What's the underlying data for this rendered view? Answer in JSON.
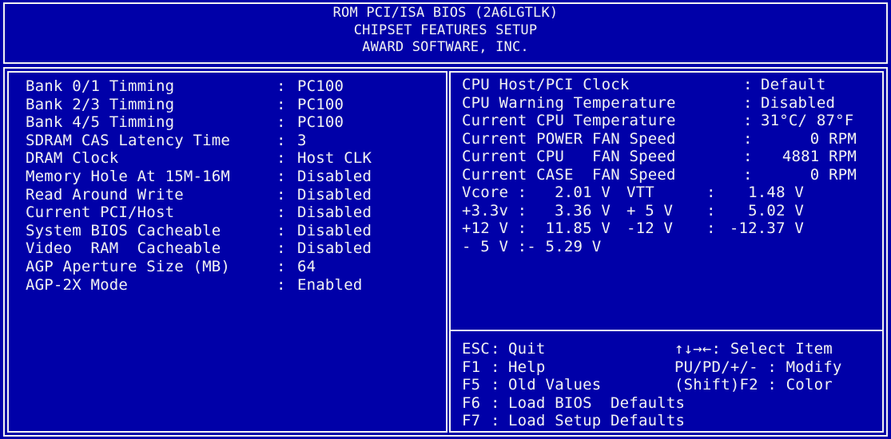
{
  "header": {
    "line1": "ROM PCI/ISA BIOS (2A6LGTLK)",
    "line2": "CHIPSET FEATURES SETUP",
    "line3": "AWARD SOFTWARE, INC."
  },
  "left_settings": [
    {
      "label": "Bank 0/1 Timming",
      "value": "PC100"
    },
    {
      "label": "Bank 2/3 Timming",
      "value": "PC100"
    },
    {
      "label": "Bank 4/5 Timming",
      "value": "PC100"
    },
    {
      "label": "SDRAM CAS Latency Time",
      "value": "3"
    },
    {
      "label": "DRAM Clock",
      "value": "Host CLK"
    },
    {
      "label": "Memory Hole At 15M-16M",
      "value": "Disabled"
    },
    {
      "label": "Read Around Write",
      "value": "Disabled"
    },
    {
      "label": "Current PCI/Host",
      "value": "Disabled"
    },
    {
      "label": "System BIOS Cacheable",
      "value": "Disabled"
    },
    {
      "label": "Video  RAM  Cacheable",
      "value": "Disabled"
    },
    {
      "label": "AGP Aperture Size (MB)",
      "value": "64"
    },
    {
      "label": "AGP-2X Mode",
      "value": "Enabled"
    }
  ],
  "right_settings": [
    {
      "label": "CPU Host/PCI Clock",
      "value": "Default"
    },
    {
      "label": "CPU Warning Temperature",
      "value": "Disabled"
    },
    {
      "label": "Current CPU Temperature",
      "value": "31°C/ 87°F"
    },
    {
      "label": "Current POWER FAN Speed",
      "value": "0 RPM"
    },
    {
      "label": "Current CPU   FAN Speed",
      "value": "4881 RPM"
    },
    {
      "label": "Current CASE  FAN Speed",
      "value": "0 RPM"
    }
  ],
  "voltages": [
    {
      "l1": "Vcore",
      "v1": "2.01 V",
      "l2": "VTT",
      "v2": "1.48 V"
    },
    {
      "l1": "+3.3v",
      "v1": "3.36 V",
      "l2": "+ 5 V",
      "v2": "5.02 V"
    },
    {
      "l1": "+12 V",
      "v1": "11.85 V",
      "l2": "-12 V",
      "v2": "-12.37 V"
    }
  ],
  "minus5": {
    "label": "- 5 V",
    "value": "- 5.29 V"
  },
  "help": {
    "esc_key": "ESC",
    "esc_desc": "Quit",
    "select": "↑↓→←: Select Item",
    "f1_key": "F1",
    "f1_desc": "Help",
    "modify": "PU/PD/+/- : Modify",
    "f5_key": "F5",
    "f5_desc": "Old Values",
    "color": "(Shift)F2 : Color",
    "f6_key": "F6",
    "f6_desc": "Load BIOS  Defaults",
    "f7_key": "F7",
    "f7_desc": "Load Setup Defaults"
  },
  "colors": {
    "background": "#0000a8",
    "text": "#f2f2f2"
  }
}
